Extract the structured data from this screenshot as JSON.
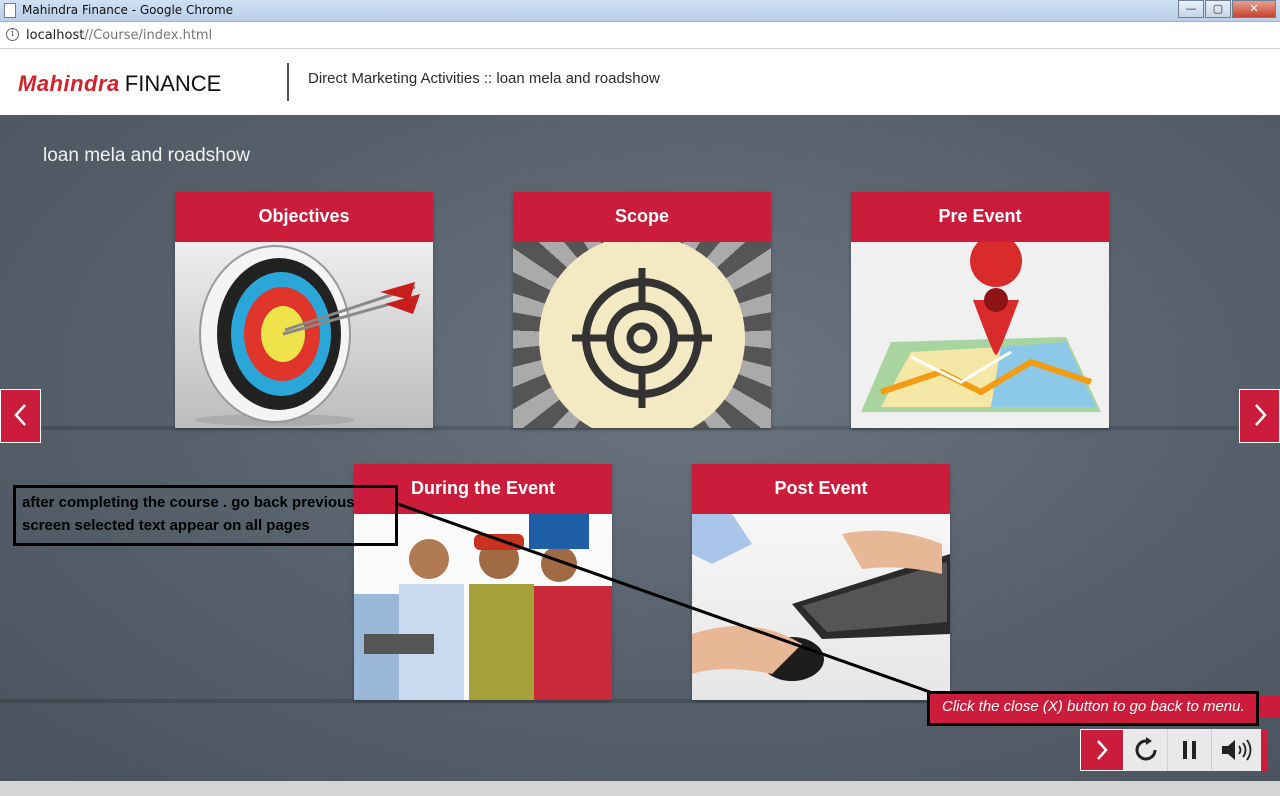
{
  "window": {
    "title": "Mahindra Finance - Google Chrome",
    "url_host": "localhost",
    "url_path": "//Course/index.html"
  },
  "header": {
    "logo_red": "Mahindra",
    "logo_black": "FINANCE",
    "title": "Direct Marketing Activities :: loan mela and roadshow"
  },
  "main": {
    "title": "loan mela and roadshow",
    "cards": [
      {
        "label": "Objectives",
        "image": "archery-target-with-arrows"
      },
      {
        "label": "Scope",
        "image": "crosshair-target-icon"
      },
      {
        "label": "Pre Event",
        "image": "map-with-location-pin"
      },
      {
        "label": "During the Event",
        "image": "group-looking-at-laptop-photo"
      },
      {
        "label": "Post Event",
        "image": "hands-on-keyboard-and-mouse-photo"
      }
    ],
    "prev_icon": "chevron-left-icon",
    "next_icon": "chevron-right-icon"
  },
  "annotation": {
    "line1": "after completing the course . go back previous",
    "line2": "screen selected text appear on all pages"
  },
  "hint": "Click the close (X) button to go back to menu.",
  "controls": {
    "next_icon": "chevron-right-icon",
    "replay_icon": "replay-icon",
    "pause_icon": "pause-icon",
    "volume_icon": "volume-icon"
  },
  "colors": {
    "accent": "#cc1c3c",
    "stage": "#56606b",
    "brand_red": "#d2232a"
  }
}
